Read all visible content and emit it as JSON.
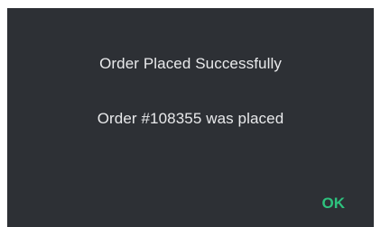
{
  "dialog": {
    "title": "Order Placed Successfully",
    "message": "Order #108355 was placed",
    "ok_label": "OK",
    "colors": {
      "background": "#2d3035",
      "text": "#e9eaec",
      "accent": "#2ec27e"
    }
  }
}
